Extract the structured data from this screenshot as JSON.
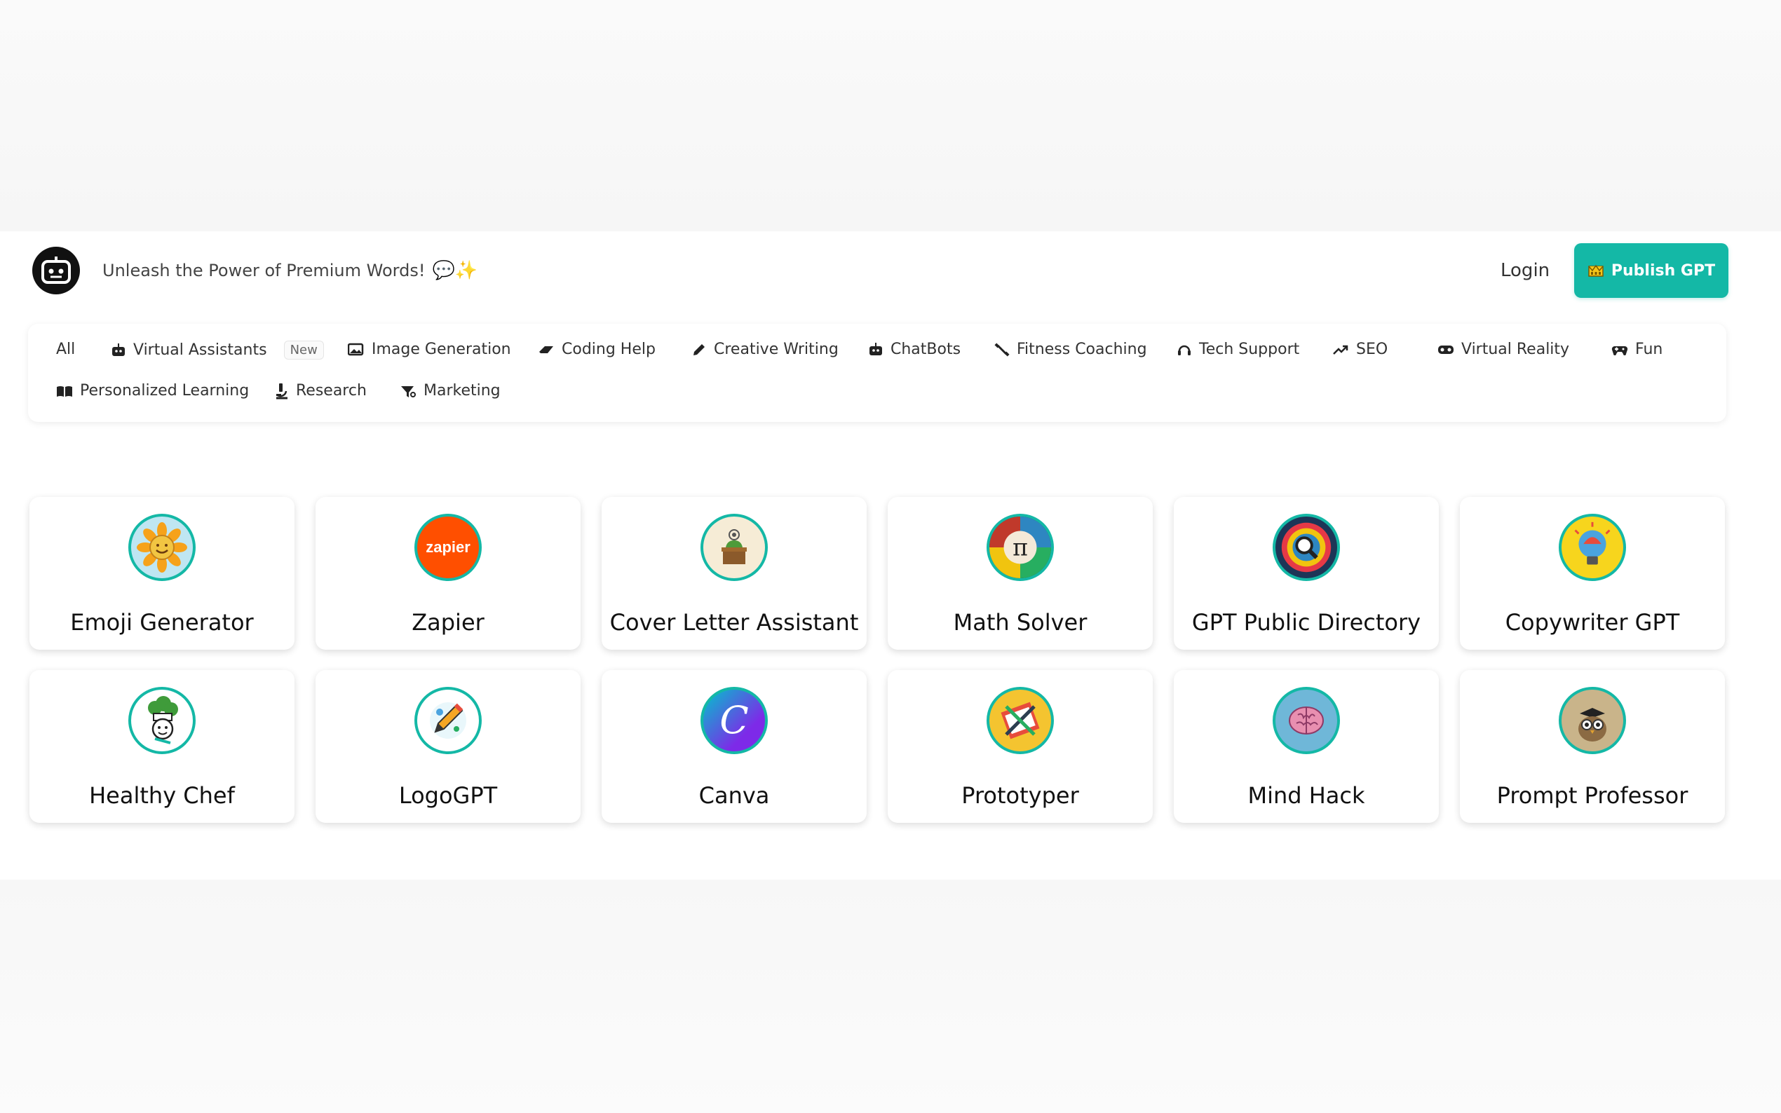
{
  "header": {
    "tagline": "Unleash the Power of Premium Words!",
    "tagline_emojis": "💬✨",
    "login_label": "Login",
    "publish_label": "Publish GPT",
    "publish_icon": "crown-icon",
    "accent_color": "#14b8a6"
  },
  "categories": [
    {
      "label": "All",
      "icon": ""
    },
    {
      "label": "Virtual Assistants",
      "icon": "robot-icon",
      "badge": "New"
    },
    {
      "label": "Image Generation",
      "icon": "image-icon"
    },
    {
      "label": "Coding Help",
      "icon": "code-icon"
    },
    {
      "label": "Creative Writing",
      "icon": "pencil-icon"
    },
    {
      "label": "ChatBots",
      "icon": "robot-icon"
    },
    {
      "label": "Fitness Coaching",
      "icon": "dumbbell-icon"
    },
    {
      "label": "Tech Support",
      "icon": "headset-icon"
    },
    {
      "label": "SEO",
      "icon": "trending-up-icon"
    },
    {
      "label": "Virtual Reality",
      "icon": "vr-headset-icon"
    },
    {
      "label": "Fun",
      "icon": "gamepad-icon"
    },
    {
      "label": "Personalized Learning",
      "icon": "book-icon"
    },
    {
      "label": "Research",
      "icon": "microscope-icon"
    },
    {
      "label": "Marketing",
      "icon": "megaphone-icon"
    }
  ],
  "gpts": [
    {
      "title": "Emoji Generator",
      "icon": "sunflower-icon"
    },
    {
      "title": "Zapier",
      "icon": "zapier-logo"
    },
    {
      "title": "Cover Letter Assistant",
      "icon": "letter-icon"
    },
    {
      "title": "Math Solver",
      "icon": "pi-icon"
    },
    {
      "title": "GPT Public Directory",
      "icon": "magnifier-icon"
    },
    {
      "title": "Copywriter GPT",
      "icon": "lightbulb-icon"
    },
    {
      "title": "Healthy Chef",
      "icon": "chef-broccoli-icon"
    },
    {
      "title": "LogoGPT",
      "icon": "pencil-logo-icon"
    },
    {
      "title": "Canva",
      "icon": "canva-logo"
    },
    {
      "title": "Prototyper",
      "icon": "tools-icon"
    },
    {
      "title": "Mind Hack",
      "icon": "brain-icon"
    },
    {
      "title": "Prompt Professor",
      "icon": "owl-icon"
    }
  ]
}
